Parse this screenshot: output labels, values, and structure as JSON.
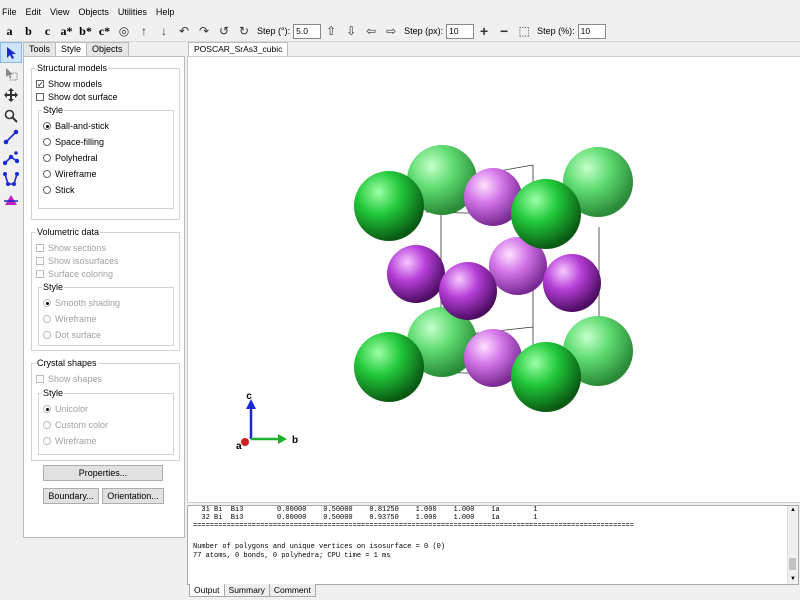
{
  "menubar": [
    "File",
    "Edit",
    "View",
    "Objects",
    "Utilities",
    "Help"
  ],
  "toolbar": {
    "axes": [
      "a",
      "b",
      "c",
      "a*",
      "b*",
      "c*"
    ],
    "step_deg_label": "Step (°):",
    "step_deg_value": "5.0",
    "step_px_label": "Step (px):",
    "step_px_value": "10",
    "step_pct_label": "Step (%):",
    "step_pct_value": "10"
  },
  "left_tools": [
    "select-arrow-icon",
    "select-box-icon",
    "move-icon",
    "magnify-icon",
    "bond-distance-icon",
    "bond-angle-icon",
    "dihedral-icon",
    "lattice-plane-icon"
  ],
  "panel": {
    "tabs": [
      "Tools",
      "Style",
      "Objects"
    ],
    "active_tab": "Style",
    "structural": {
      "title": "Structural models",
      "show_models": "Show models",
      "show_dot_surface": "Show dot surface",
      "style_title": "Style",
      "styles": [
        "Ball-and-stick",
        "Space-filling",
        "Polyhedral",
        "Wireframe",
        "Stick"
      ],
      "selected_style": "Ball-and-stick"
    },
    "volumetric": {
      "title": "Volumetric data",
      "items": [
        "Show sections",
        "Show isosurfaces",
        "Surface coloring"
      ],
      "style_title": "Style",
      "styles": [
        "Smooth shading",
        "Wireframe",
        "Dot surface"
      ]
    },
    "crystal": {
      "title": "Crystal shapes",
      "show_shapes": "Show shapes",
      "style_title": "Style",
      "styles": [
        "Unicolor",
        "Custom color",
        "Wireframe"
      ]
    },
    "buttons": {
      "properties": "Properties...",
      "boundary": "Boundary...",
      "orientation": "Orientation..."
    }
  },
  "document_tab": "POSCAR_SrAs3_cubic",
  "viewer": {
    "axis_labels": {
      "a": "a",
      "b": "b",
      "c": "c"
    },
    "colors": {
      "green_atom": "#22c93a",
      "purple_atom": "#b63fd8",
      "axis_a": "#d02020",
      "axis_b": "#20b030",
      "axis_c": "#1a2ad0"
    }
  },
  "output": {
    "lines": [
      "  31 Bi  Bi3        0.00000    0.50000    0.81250    1.000    1.000    1a        1",
      "  32 Bi  Bi3        0.00000    0.50000    0.93750    1.000    1.000    1a        1",
      "=========================================================================================================",
      "",
      "Number of polygons and unique vertices on isosurface = 0 (0)",
      "77 atoms, 0 bonds, 0 polyhedra; CPU time = 1 ms"
    ],
    "tabs": [
      "Output",
      "Summary",
      "Comment"
    ],
    "active_tab": "Output"
  }
}
